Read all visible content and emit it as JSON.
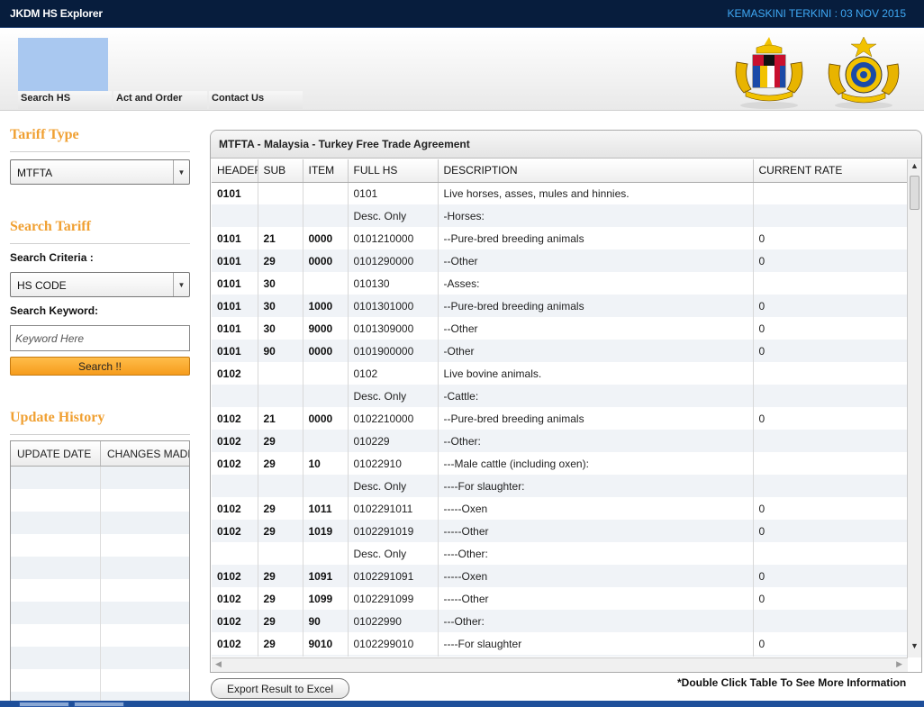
{
  "app": {
    "title": "JKDM HS Explorer",
    "last_update": "KEMASKINI TERKINI : 03 NOV 2015"
  },
  "nav": {
    "tabs": [
      "Search HS",
      "Act and Order",
      "Contact Us"
    ]
  },
  "sidebar": {
    "tariff_type_heading": "Tariff Type",
    "tariff_type_value": "MTFTA",
    "search_tariff_heading": "Search Tariff",
    "search_criteria_label": "Search Criteria :",
    "search_criteria_value": "HS CODE",
    "search_keyword_label": "Search Keyword:",
    "keyword_placeholder": "Keyword Here",
    "search_button": "Search !!",
    "update_history_heading": "Update History",
    "history_columns": [
      "UPDATE DATE",
      "CHANGES MADE"
    ]
  },
  "panel": {
    "title": "MTFTA - Malaysia - Turkey Free Trade Agreement",
    "columns": [
      "HEADER",
      "SUB",
      "ITEM",
      "FULL HS",
      "DESCRIPTION",
      "CURRENT RATE"
    ],
    "rows": [
      [
        "0101",
        "",
        "",
        "0101",
        "Live horses, asses, mules and hinnies.",
        ""
      ],
      [
        "",
        "",
        "",
        "Desc. Only",
        "-Horses:",
        ""
      ],
      [
        "0101",
        "21",
        "0000",
        "0101210000",
        "--Pure-bred breeding animals",
        "0"
      ],
      [
        "0101",
        "29",
        "0000",
        "0101290000",
        "--Other",
        "0"
      ],
      [
        "0101",
        "30",
        "",
        "010130",
        "-Asses:",
        ""
      ],
      [
        "0101",
        "30",
        "1000",
        "0101301000",
        "--Pure-bred breeding animals",
        "0"
      ],
      [
        "0101",
        "30",
        "9000",
        "0101309000",
        "--Other",
        "0"
      ],
      [
        "0101",
        "90",
        "0000",
        "0101900000",
        "-Other",
        "0"
      ],
      [
        "0102",
        "",
        "",
        "0102",
        "Live bovine animals.",
        ""
      ],
      [
        "",
        "",
        "",
        "Desc. Only",
        "-Cattle:",
        ""
      ],
      [
        "0102",
        "21",
        "0000",
        "0102210000",
        "--Pure-bred breeding animals",
        "0"
      ],
      [
        "0102",
        "29",
        "",
        "010229",
        "--Other:",
        ""
      ],
      [
        "0102",
        "29",
        "10",
        "01022910",
        "---Male cattle (including oxen):",
        ""
      ],
      [
        "",
        "",
        "",
        "Desc. Only",
        "----For slaughter:",
        ""
      ],
      [
        "0102",
        "29",
        "1011",
        "0102291011",
        "-----Oxen",
        "0"
      ],
      [
        "0102",
        "29",
        "1019",
        "0102291019",
        "-----Other",
        "0"
      ],
      [
        "",
        "",
        "",
        "Desc. Only",
        "----Other:",
        ""
      ],
      [
        "0102",
        "29",
        "1091",
        "0102291091",
        "-----Oxen",
        "0"
      ],
      [
        "0102",
        "29",
        "1099",
        "0102291099",
        "-----Other",
        "0"
      ],
      [
        "0102",
        "29",
        "90",
        "01022990",
        "---Other:",
        ""
      ],
      [
        "0102",
        "29",
        "9010",
        "0102299010",
        "----For slaughter",
        "0"
      ],
      [
        "",
        "",
        "",
        "",
        "",
        ""
      ]
    ],
    "export_button": "Export Result to Excel",
    "hint": "*Double Click Table To See More Information"
  },
  "colors": {
    "topbar": "#071d3d",
    "accent_orange": "#f0a032",
    "update_text": "#3fa9f5"
  }
}
